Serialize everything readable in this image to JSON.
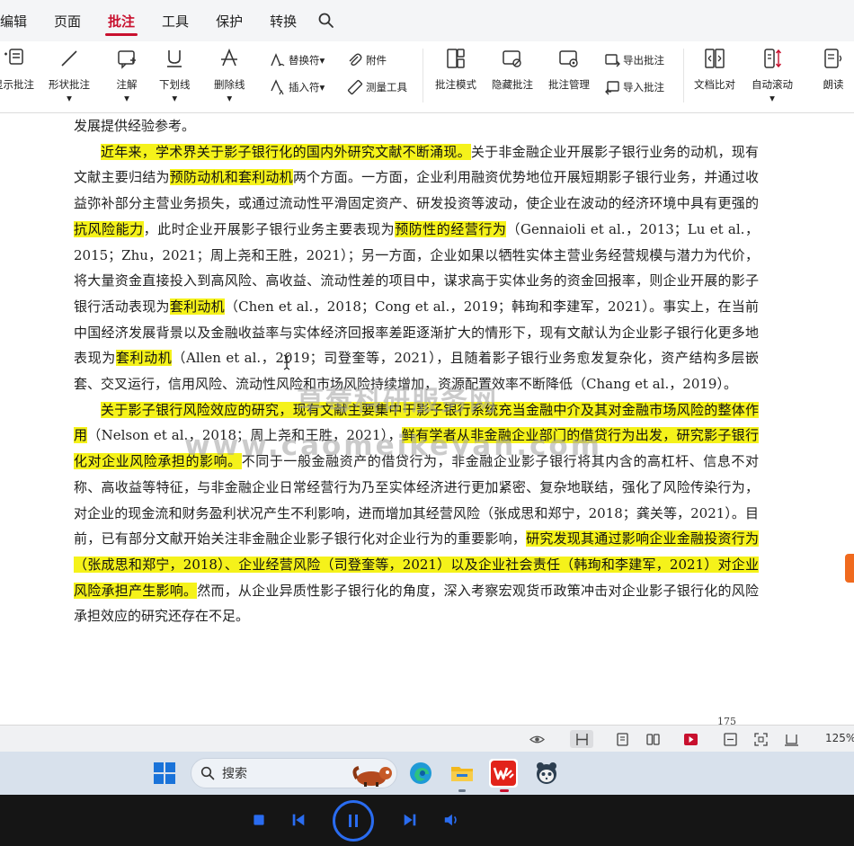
{
  "menu": {
    "items": [
      "编辑",
      "页面",
      "批注",
      "工具",
      "保护",
      "转换"
    ],
    "active_index": 2,
    "accent_color": "#c8102e"
  },
  "ribbon": {
    "show_comments": "显示批注",
    "shape_comment": "形状批注",
    "annotate": "注解",
    "underline": "下划线",
    "strikethrough": "删除线",
    "replace_mark": "替换符",
    "insert_mark": "插入符",
    "attachment": "附件",
    "measure_tool": "测量工具",
    "comment_mode": "批注模式",
    "hide_comments": "隐藏批注",
    "manage_comments": "批注管理",
    "export_comments": "导出批注",
    "import_comments": "导入批注",
    "compare_docs": "文档比对",
    "auto_scroll": "自动滚动",
    "read_aloud": "朗读"
  },
  "document": {
    "p0": "发展提供经验参考。",
    "p1": [
      {
        "t": "近年来，学术界关于影子银行化的国内外研究文献不断涌现。",
        "hl": true
      },
      {
        "t": "关于非金融企业开展影子银行业务的动机，现有文献主要归结为",
        "hl": false
      },
      {
        "t": "预防动机和套利动机",
        "hl": true
      },
      {
        "t": "两个方面。一方面，企业利用融资优势地位开展短期影子银行业务，并通过收益弥补部分主营业务损失，或通过流动性平滑固定资产、研发投资等波动，使企业在波动的经济环境中具有更强的",
        "hl": false
      },
      {
        "t": "抗风险能力",
        "hl": true
      },
      {
        "t": "，此时企业开展影子银行业务主要表现为",
        "hl": false
      },
      {
        "t": "预防性的经营行为",
        "hl": true
      },
      {
        "t": "（Gennaioli et al.，2013；Lu et al.，2015；Zhu，2021；周上尧和王胜，2021）；另一方面，企业如果以牺牲实体主营业务经营规模与潜力为代价，将大量资金直接投入到高风险、高收益、流动性差的项目中，谋求高于实体业务的资金回报率，则企业开展的影子银行活动表现为",
        "hl": false
      },
      {
        "t": "套利动机",
        "hl": true
      },
      {
        "t": "（Chen et al.，2018；Cong et al.，2019；韩珣和李建军，2021）。事实上，在当前中国经济发展背景以及金融收益率与实体经济回报率差距逐渐扩大的情形下，现有文献认为企业影子银行化更多地表现为",
        "hl": false
      },
      {
        "t": "套利动机",
        "hl": true
      },
      {
        "t": "（Allen et al.，2019；司登奎等，2021），且随着影子银行业务愈发复杂化，资产结构多层嵌套、交叉运行，信用风险、流动性风险和市场风险持续增加，资源配置效率不断降低（Chang et al.，2019）。",
        "hl": false
      }
    ],
    "p2": [
      {
        "t": "关于影子银行风险效应的研究，现有文献主要集中于影子银行系统充当金融中介及其对金融市场风险的整体作用",
        "hl": true
      },
      {
        "t": "（Nelson et al.，2018；周上尧和王胜，2021），",
        "hl": false
      },
      {
        "t": "鲜有学者从非金融企业部门的借贷行为出发，研究影子银行化对企业风险承担的影响。",
        "hl": true
      },
      {
        "t": "不同于一般金融资产的借贷行为，非金融企业影子银行将其内含的高杠杆、信息不对称、高收益等特征，与非金融企业日常经营行为乃至实体经济进行更加紧密、复杂地联结，强化了风险传染行为，对企业的现金流和财务盈利状况产生不利影响，进而增加其经营风险（张成思和郑宁，2018；龚关等，2021）。目前，已有部分文献开始关注非金融企业影子银行化对企业行为的重要影响，",
        "hl": false
      },
      {
        "t": "研究发现其通过影响企业金融投资行为（张成思和郑宁，2018）、企业经营风险（司登奎等，2021）以及企业社会责任（韩珣和李建军，2021）对企业风险承担产生影响。",
        "hl": true
      },
      {
        "t": "然而，从企业异质性影子银行化的角度，深入考察宏观货币政策冲击对企业影子银行化的风险承担效应的研究还存在不足。",
        "hl": false
      }
    ],
    "highlight_color": "#f5f21a",
    "watermark_line1": "草莓科研服务网",
    "watermark_line2": "www.caomeikeyan.com",
    "page_number": "175"
  },
  "statusbar": {
    "zoom": "125%"
  },
  "taskbar": {
    "search_label": "搜索"
  },
  "mediabar": {
    "accent_color": "#2a6cf0"
  }
}
